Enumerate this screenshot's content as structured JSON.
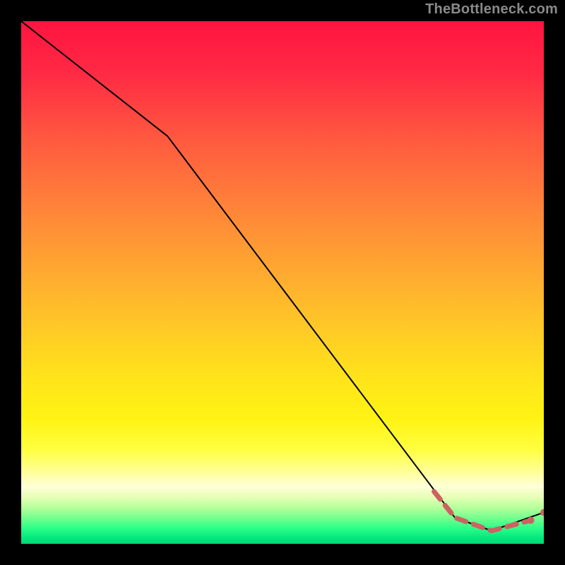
{
  "watermark": "TheBottleneck.com",
  "colors": {
    "curve": "#000000",
    "dash": "#cc6262",
    "dot": "#cc6262",
    "gradient_top": "#ff1440",
    "gradient_bottom": "#00d873",
    "bg": "#000000"
  },
  "chart_data": {
    "type": "line",
    "title": "",
    "xlabel": "",
    "ylabel": "",
    "xlim": [
      0,
      100
    ],
    "ylim": [
      0,
      100
    ],
    "series": [
      {
        "name": "curve",
        "style": "solid-black",
        "x": [
          0,
          28,
          83,
          90,
          100
        ],
        "values": [
          100,
          78,
          5,
          2.5,
          6
        ]
      },
      {
        "name": "highlighted-segment",
        "style": "dashed-red",
        "x": [
          79,
          83,
          90,
          97.5
        ],
        "values": [
          10,
          5,
          2.5,
          4.5
        ]
      }
    ],
    "points": [
      {
        "x": 97.5,
        "y": 4.5
      },
      {
        "x": 100,
        "y": 6
      }
    ],
    "annotations": []
  }
}
